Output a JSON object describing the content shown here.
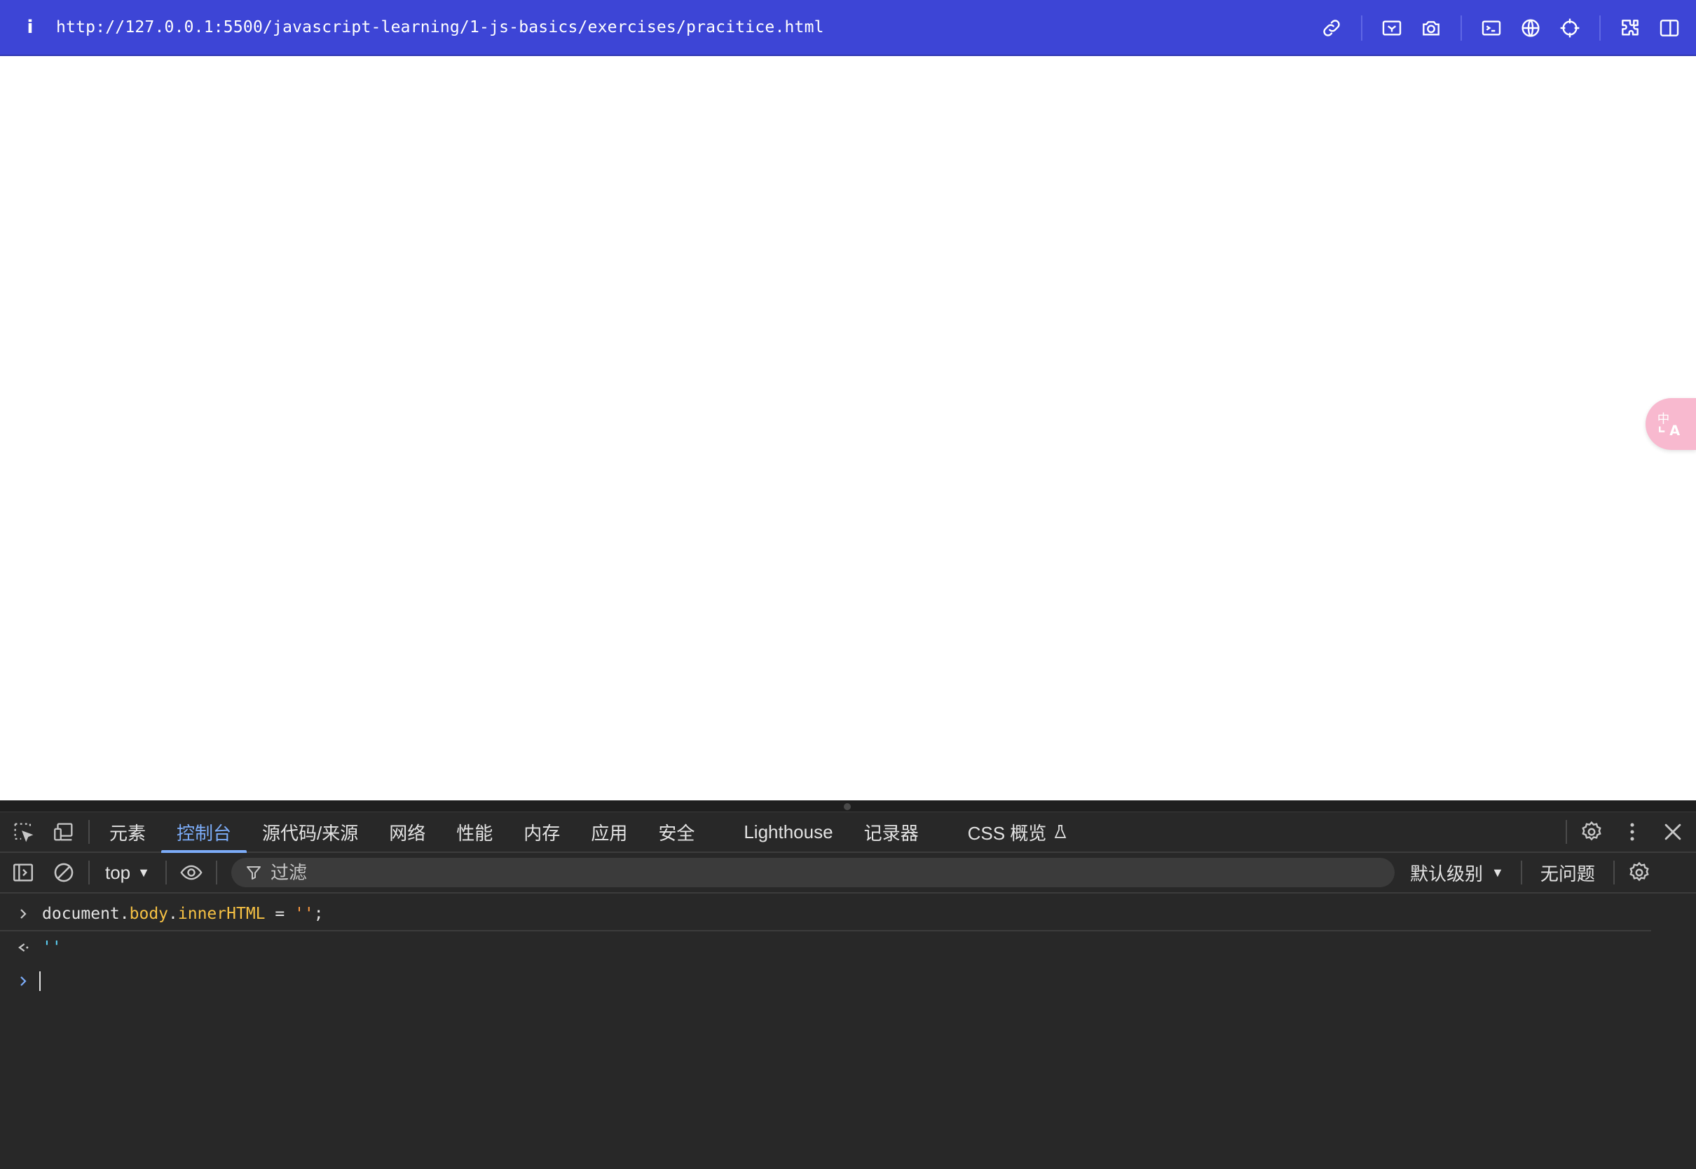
{
  "browser": {
    "info_label": "i",
    "url": "http://127.0.0.1:5500/javascript-learning/1-js-basics/exercises/pracitice.html"
  },
  "translate_fab": {
    "label": "中A"
  },
  "devtools": {
    "tabs": [
      "元素",
      "控制台",
      "源代码/来源",
      "网络",
      "性能",
      "内存",
      "应用",
      "安全",
      "Lighthouse",
      "记录器",
      "CSS 概览"
    ],
    "active_tab": "控制台",
    "toolbar": {
      "context": "top",
      "filter_placeholder": "过滤",
      "levels": "默认级别",
      "issues": "无问题"
    },
    "console": {
      "command": {
        "t1": "document",
        "t2": ".",
        "t3": "body",
        "t4": ".",
        "t5": "innerHTML",
        "t6": " = ",
        "t7": "''",
        "t8": ";"
      },
      "result": "''"
    }
  },
  "colors": {
    "address_bar": "#3d45d6",
    "devtools_bg": "#282828",
    "active_tab": "#7cacf8",
    "string_result": "#5cd5fb",
    "property": "#f6c144",
    "string": "#fc9a40"
  }
}
